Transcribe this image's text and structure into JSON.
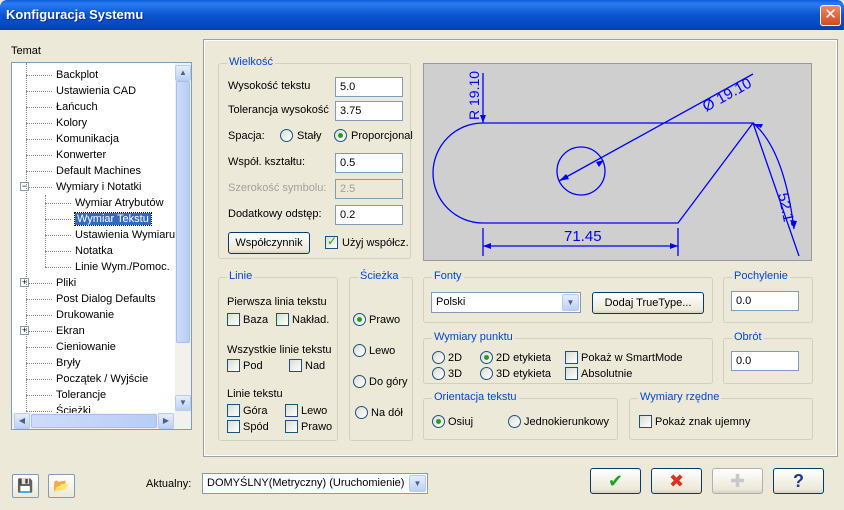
{
  "window": {
    "title": "Konfiguracja Systemu",
    "close_glyph": "✕"
  },
  "tree": {
    "label": "Temat",
    "items": [
      {
        "label": "Backplot",
        "level": 1
      },
      {
        "label": "Ustawienia CAD",
        "level": 1
      },
      {
        "label": "Łańcuch",
        "level": 1
      },
      {
        "label": "Kolory",
        "level": 1
      },
      {
        "label": "Komunikacja",
        "level": 1
      },
      {
        "label": "Konwerter",
        "level": 1
      },
      {
        "label": "Default Machines",
        "level": 1
      },
      {
        "label": "Wymiary i Notatki",
        "level": 1,
        "expander": "−"
      },
      {
        "label": "Wymiar Atrybutów",
        "level": 2
      },
      {
        "label": "Wymiar Tekstu",
        "level": 2,
        "selected": true
      },
      {
        "label": "Ustawienia Wymiaru",
        "level": 2
      },
      {
        "label": "Notatka",
        "level": 2
      },
      {
        "label": "Linie Wym./Pomoc.",
        "level": 2
      },
      {
        "label": "Pliki",
        "level": 1,
        "expander": "+"
      },
      {
        "label": "Post Dialog Defaults",
        "level": 1
      },
      {
        "label": "Drukowanie",
        "level": 1
      },
      {
        "label": "Ekran",
        "level": 1,
        "expander": "+"
      },
      {
        "label": "Cieniowanie",
        "level": 1
      },
      {
        "label": "Bryły",
        "level": 1
      },
      {
        "label": "Początek / Wyjście",
        "level": 1
      },
      {
        "label": "Tolerancje",
        "level": 1
      },
      {
        "label": "Ścieżki",
        "level": 1
      }
    ]
  },
  "wielkosc": {
    "title": "Wielkość",
    "wysokosc_label": "Wysokość tekstu",
    "wysokosc_value": "5.0",
    "tolerancja_label": "Tolerancja wysokość",
    "tolerancja_value": "3.75",
    "spacja_label": "Spacja:",
    "staly_label": "Stały",
    "proporcjonal_label": "Proporcjonal",
    "wspol_label": "Współ. kształtu:",
    "wspol_value": "0.5",
    "szerokosc_label": "Szerokość symbolu:",
    "szerokosc_value": "2.5",
    "dodatkowy_label": "Dodatkowy odstęp:",
    "dodatkowy_value": "0.2",
    "wspolczynnik_button": "Współczynnik",
    "uzyj_label": "Użyj współcz."
  },
  "preview": {
    "radius_label": "R 19.10",
    "diameter_label": "Ø 19.10",
    "angle_label": "52.1°",
    "length_label": "71.45"
  },
  "linie": {
    "title": "Linie",
    "pierwsza_label": "Pierwsza linia tekstu",
    "baza": "Baza",
    "nakladka": "Nakład.",
    "wszystkie_label": "Wszystkie linie tekstu",
    "pod": "Pod",
    "nad": "Nad",
    "linie_tekstu_label": "Linie tekstu",
    "gora": "Góra",
    "lewo": "Lewo",
    "spod": "Spód",
    "prawo": "Prawo"
  },
  "sciezka": {
    "title": "Ścieżka",
    "prawo": "Prawo",
    "lewo": "Lewo",
    "do_gory": "Do góry",
    "na_dol": "Na dół"
  },
  "fonty": {
    "title": "Fonty",
    "selected": "Polski",
    "dodaj_button": "Dodaj TrueType..."
  },
  "pochylenie": {
    "title": "Pochylenie",
    "value": "0.0"
  },
  "obrot": {
    "title": "Obrót",
    "value": "0.0"
  },
  "wymiary_punktu": {
    "title": "Wymiary punktu",
    "opt_2d": "2D",
    "opt_2d_etykieta": "2D etykieta",
    "opt_3d": "3D",
    "opt_3d_etykieta": "3D etykieta",
    "pokaz_smartmode": "Pokaż w SmartMode",
    "absolutnie": "Absolutnie"
  },
  "orientacja": {
    "title": "Orientacja tekstu",
    "osiuj": "Osiuj",
    "jednokierunkowy": "Jednokierunkowy"
  },
  "wymiary_rzedne": {
    "title": "Wymiary rzędne",
    "pokaz_znak": "Pokaż znak ujemny"
  },
  "footer": {
    "aktualny_label": "Aktualny:",
    "aktualny_value": "DOMYŚLNY(Metryczny) (Uruchomienie)",
    "ok_glyph": "✔",
    "cancel_glyph": "✖",
    "add_glyph": "✚",
    "help_glyph": "?",
    "save_glyph": "💾",
    "open_glyph": "📂"
  },
  "colors": {
    "accent": "#0046d5",
    "check_green": "#21a121",
    "cancel_red": "#e0301e",
    "preview_bg": "#cfcfcf",
    "preview_line": "#0000ff"
  }
}
